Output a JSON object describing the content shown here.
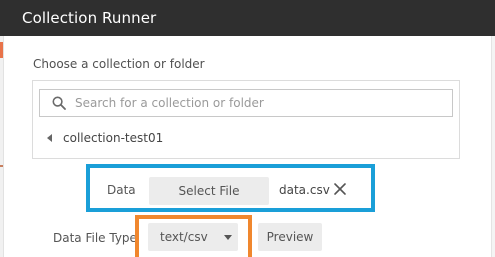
{
  "window": {
    "title": "Collection Runner"
  },
  "collection_section": {
    "label": "Choose a collection or folder",
    "search": {
      "placeholder": "Search for a collection or folder",
      "value": "",
      "icon": "search-icon"
    },
    "selected_collection": "collection-test01"
  },
  "data_section": {
    "label": "Data",
    "select_file_label": "Select File",
    "file_name": "data.csv",
    "highlight_color": "#1a9fd8"
  },
  "file_type_section": {
    "label": "Data File Type",
    "selected_value": "text/csv",
    "preview_label": "Preview",
    "highlight_color": "#f0872e"
  }
}
